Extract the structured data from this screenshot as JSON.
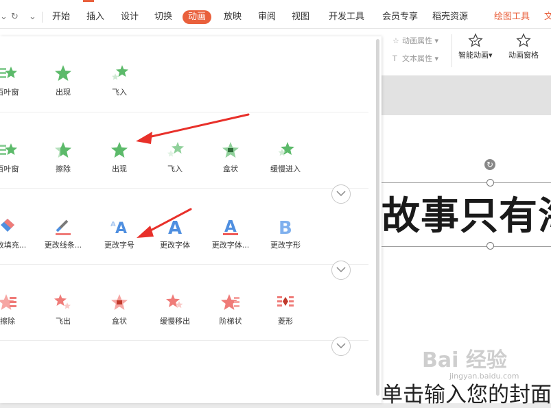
{
  "menu": {
    "quick_access": [
      "⌄",
      "↻",
      "⌄"
    ],
    "tabs": [
      "开始",
      "插入",
      "设计",
      "切换",
      "动画",
      "放映",
      "审阅",
      "视图",
      "开发工具",
      "会员专享",
      "稻壳资源",
      "绘图工具",
      "文"
    ],
    "active_tab": "动画"
  },
  "ribbon": {
    "animation_properties": "动画属性",
    "text_properties": "文本属性",
    "smart_animation": "智能动画",
    "animation_pane": "动画窗格"
  },
  "panel": {
    "rows": [
      {
        "items": [
          "百叶窗",
          "出现",
          "飞入"
        ]
      },
      {
        "items": [
          "百叶窗",
          "擦除",
          "出现",
          "飞入",
          "盒状",
          "缓慢进入"
        ]
      },
      {
        "items": [
          "更改填充...",
          "更改线条...",
          "更改字号",
          "更改字体",
          "更改字体...",
          "更改字形"
        ]
      },
      {
        "items": [
          "擦除",
          "飞出",
          "盒状",
          "缓慢移出",
          "阶梯状",
          "菱形"
        ]
      }
    ]
  },
  "slide": {
    "title": "故事只有海",
    "subtitle": "单击输入您的封面"
  },
  "watermark": {
    "text": "Bai 经验",
    "sub": "jingyan.baidu.com"
  },
  "colors": {
    "accent": "#e9603c",
    "entrance": "#5cba6a",
    "emphasis": "#4f8fe0",
    "exit": "#ef7b78",
    "arrow": "#e8302a"
  }
}
